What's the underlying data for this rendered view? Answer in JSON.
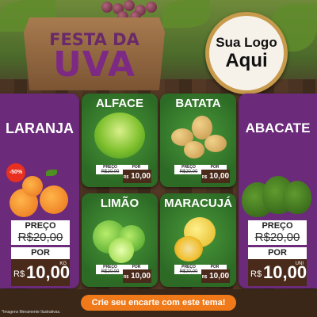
{
  "title": {
    "line1": "FESTA DA",
    "line2": "UVA"
  },
  "logo": {
    "line1": "Sua Logo",
    "line2": "Aqui"
  },
  "side_products": [
    {
      "name": "LARANJA",
      "price_label": "PREÇO",
      "old_price": "R$20,00",
      "por_label": "POR",
      "currency": "R$",
      "new_price": "10,00",
      "unit": "KG",
      "discount": "-50%"
    },
    {
      "name": "ABACATE",
      "price_label": "PREÇO",
      "old_price": "R$20,00",
      "por_label": "POR",
      "currency": "R$",
      "new_price": "10,00",
      "unit": "UNI"
    }
  ],
  "center_products": [
    {
      "name": "ALFACE",
      "price_label": "PREÇO",
      "old_price": "R$20,00",
      "por_label": "POR",
      "currency": "R$",
      "new_price": "10,00"
    },
    {
      "name": "BATATA",
      "price_label": "PREÇO",
      "old_price": "R$20,00",
      "por_label": "POR",
      "currency": "R$",
      "new_price": "10,00"
    },
    {
      "name": "LIMÃO",
      "price_label": "PREÇO",
      "old_price": "R$20,00",
      "por_label": "POR",
      "currency": "R$",
      "new_price": "10,00"
    },
    {
      "name": "MARACUJÁ",
      "price_label": "PREÇO",
      "old_price": "R$20,00",
      "por_label": "POR",
      "currency": "R$",
      "new_price": "10,00"
    }
  ],
  "cta": "Crie seu encarte com este tema!",
  "disclaimer": "*Imagens Meramente Ilustrativas.",
  "colors": {
    "purple": "#6b2a7a",
    "green": "#2c6a25",
    "orange": "#f07a1a",
    "wood": "#4a3322",
    "price_box": "#4a2a1a"
  }
}
